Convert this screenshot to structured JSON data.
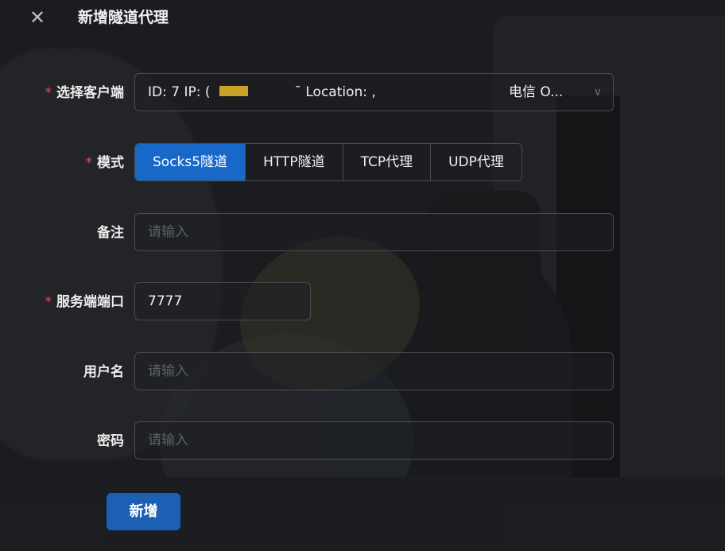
{
  "dialog": {
    "title": "新增隧道代理",
    "close_icon": "close-icon"
  },
  "form": {
    "client": {
      "label": "选择客户端",
      "required": true,
      "value_prefix": "ID: 7 IP: (",
      "value_location": "¯ Location: ,",
      "value_suffix": "电信 O...",
      "chevron_icon": "chevron-down-icon"
    },
    "mode": {
      "label": "模式",
      "required": true,
      "options": [
        "Socks5隧道",
        "HTTP隧道",
        "TCP代理",
        "UDP代理"
      ],
      "selected": "Socks5隧道"
    },
    "remark": {
      "label": "备注",
      "required": false,
      "value": "",
      "placeholder": "请输入"
    },
    "server_port": {
      "label": "服务端端口",
      "required": true,
      "value": "7777"
    },
    "username": {
      "label": "用户名",
      "required": false,
      "value": "",
      "placeholder": "请输入"
    },
    "password": {
      "label": "密码",
      "required": false,
      "value": "",
      "placeholder": "请输入"
    },
    "submit_label": "新增"
  },
  "colors": {
    "accent": "#1768c9",
    "required_mark": "#e34d59",
    "redaction": "#c9a227"
  }
}
